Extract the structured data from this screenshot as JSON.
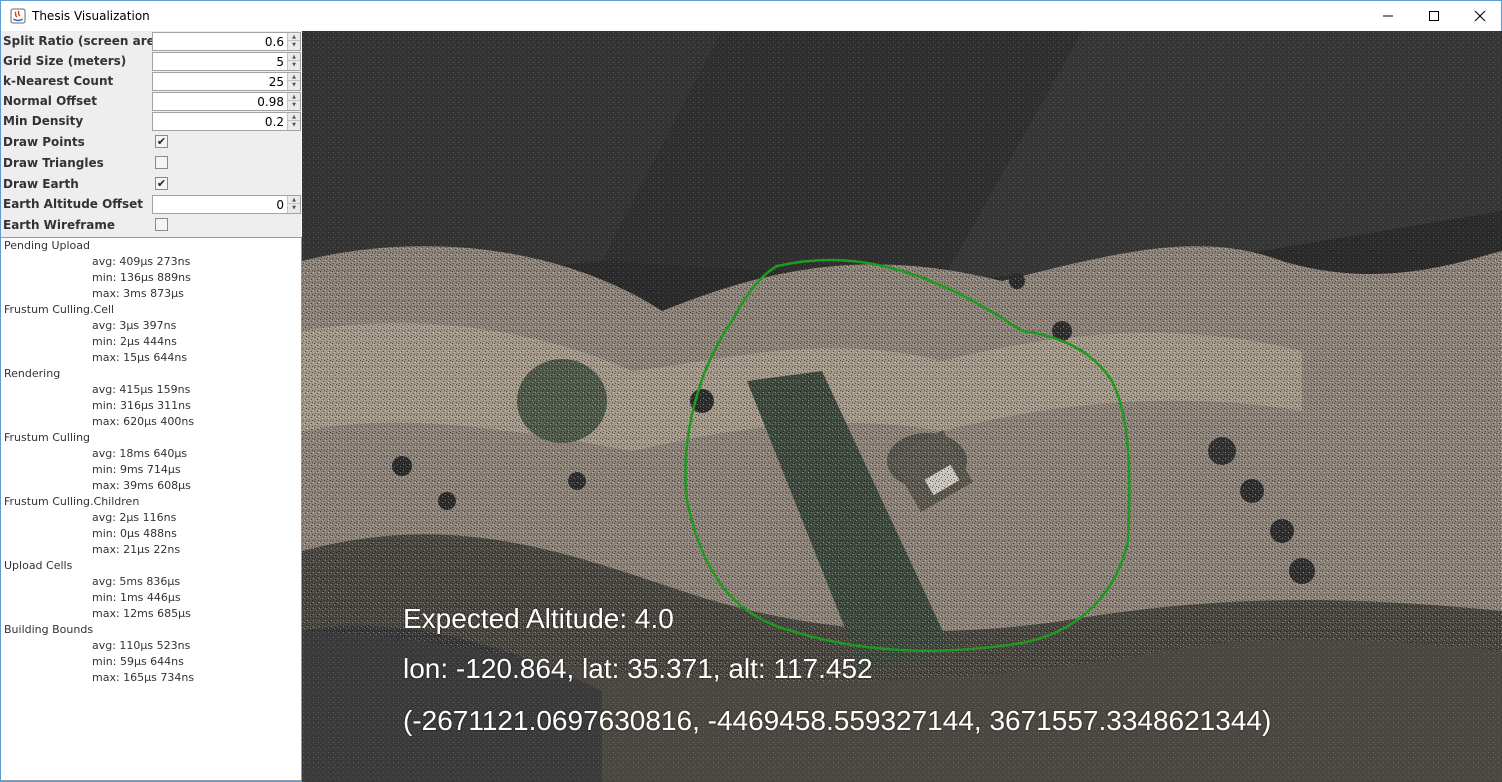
{
  "window": {
    "title": "Thesis Visualization",
    "controls": {
      "minimize": "—",
      "maximize": "☐",
      "close": "✕"
    }
  },
  "settings": {
    "split_ratio": {
      "label": "Split Ratio (screen area)",
      "value": "0.6"
    },
    "grid_size": {
      "label": "Grid Size (meters)",
      "value": "5"
    },
    "k_nearest": {
      "label": "k-Nearest Count",
      "value": "25"
    },
    "normal_offset": {
      "label": "Normal Offset",
      "value": "0.98"
    },
    "min_density": {
      "label": "Min Density",
      "value": "0.2"
    },
    "draw_points": {
      "label": "Draw Points",
      "checked": true,
      "mark": "✔"
    },
    "draw_triangles": {
      "label": "Draw Triangles",
      "checked": false,
      "mark": ""
    },
    "draw_earth": {
      "label": "Draw Earth",
      "checked": true,
      "mark": "✔"
    },
    "earth_altitude_offset": {
      "label": "Earth Altitude Offset",
      "value": "0"
    },
    "earth_wireframe": {
      "label": "Earth Wireframe",
      "checked": false,
      "mark": ""
    }
  },
  "stats": [
    {
      "name": "Pending Upload",
      "avg": "avg: 409µs 273ns",
      "min": "min: 136µs 889ns",
      "max": "max: 3ms 873µs"
    },
    {
      "name": "Frustum Culling.Cell",
      "avg": "avg: 3µs 397ns",
      "min": "min: 2µs 444ns",
      "max": "max: 15µs 644ns"
    },
    {
      "name": "Rendering",
      "avg": "avg: 415µs 159ns",
      "min": "min: 316µs 311ns",
      "max": "max: 620µs 400ns"
    },
    {
      "name": "Frustum Culling",
      "avg": "avg: 18ms 640µs",
      "min": "min: 9ms 714µs",
      "max": "max: 39ms 608µs"
    },
    {
      "name": "Frustum Culling.Children",
      "avg": "avg: 2µs 116ns",
      "min": "min: 0µs 488ns",
      "max": "max: 21µs 22ns"
    },
    {
      "name": "Upload Cells",
      "avg": "avg: 5ms 836µs",
      "min": "min: 1ms 446µs",
      "max": "max: 12ms 685µs"
    },
    {
      "name": "Building Bounds",
      "avg": "avg: 110µs 523ns",
      "min": "min: 59µs 644ns",
      "max": "max: 165µs 734ns"
    }
  ],
  "viewport": {
    "expected_altitude": "Expected Altitude: 4.0",
    "geo_coords": "lon: -120.864, lat: 35.371, alt: 117.452",
    "ecef_coords": "(-2671121.0697630816, -4469458.559327144, 3671557.3348621344)",
    "boundary_color": "#1f9a1f"
  }
}
